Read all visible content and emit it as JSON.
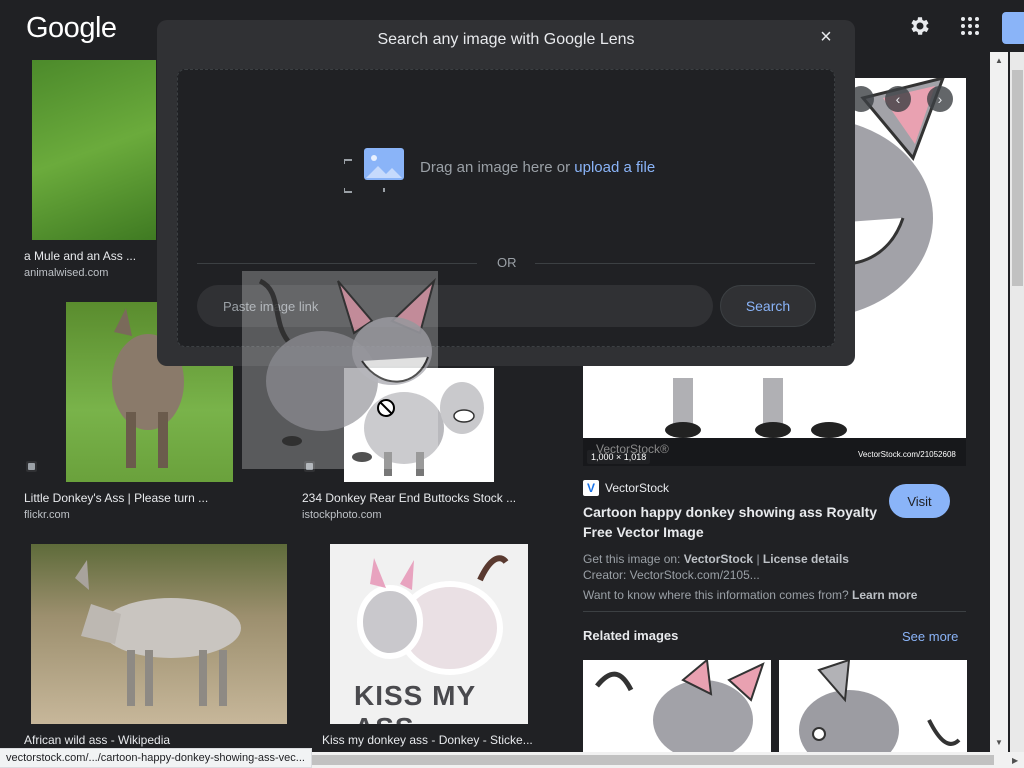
{
  "header": {
    "logo": "Google",
    "icons": [
      "gear-icon",
      "apps-icon"
    ]
  },
  "results": [
    {
      "caption": "a Mule and an Ass ...",
      "source": "animalwised.com"
    },
    {
      "caption": "Little Donkey's Ass | Please turn ...",
      "source": "flickr.com"
    },
    {
      "caption": "234 Donkey Rear End Buttocks Stock ...",
      "source": "istockphoto.com"
    },
    {
      "caption": "African wild ass - Wikipedia",
      "source": ""
    },
    {
      "caption": "Kiss my donkey ass - Donkey - Sticke...",
      "source": "",
      "sticker_text": "KISS MY ASS"
    }
  ],
  "panel": {
    "dimensions": "1,000 × 1,018",
    "watermark": "VectorStock®",
    "stamp": "VectorStock.com/21052608",
    "site_name": "VectorStock",
    "title": "Cartoon happy donkey showing ass Royalty Free Vector Image",
    "visit_label": "Visit",
    "get_image_prefix": "Get this image on:",
    "get_image_site": "VectorStock",
    "separator": "|",
    "license_label": "License details",
    "creator": "Creator: VectorStock.com/2105...",
    "info_question": "Want to know where this information comes from?",
    "learn_more": "Learn more",
    "related_label": "Related images",
    "see_more": "See more"
  },
  "lens": {
    "title": "Search any image with Google Lens",
    "drag_text": "Drag an image here or",
    "upload_link": "upload a file",
    "or_label": "OR",
    "link_placeholder": "Paste image link",
    "search_label": "Search"
  },
  "status_url": "vectorstock.com/.../cartoon-happy-donkey-showing-ass-vec...",
  "colors": {
    "background": "#202124",
    "modal": "#303134",
    "accent": "#8ab4f8"
  }
}
